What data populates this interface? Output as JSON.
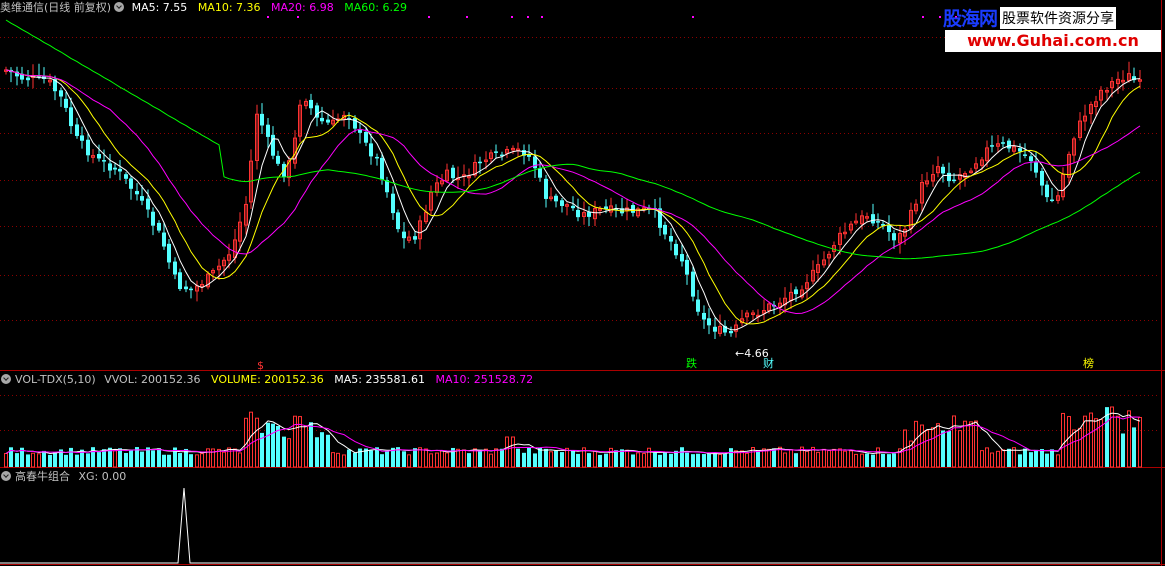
{
  "main_panel": {
    "stock_title": "奥维通信(日线 前复权)",
    "indicators": [
      {
        "label": "MA5: 7.55",
        "color": "#ffffff"
      },
      {
        "label": "MA10: 7.36",
        "color": "#ffff00"
      },
      {
        "label": "MA20: 6.98",
        "color": "#ff00ff"
      },
      {
        "label": "MA60: 6.29",
        "color": "#00ff00"
      }
    ],
    "low_price_label": "4.66",
    "signals": {
      "s1": "$",
      "s2": "跌",
      "s3": "财",
      "s4": "榜"
    }
  },
  "volume_panel": {
    "title": "VOL-TDX(5,10)",
    "indicators": [
      {
        "label": "VVOL: 200152.36",
        "color": "#c0c0c0"
      },
      {
        "label": "VOLUME: 200152.36",
        "color": "#ffff00"
      },
      {
        "label": "MA5: 235581.61",
        "color": "#ffffff"
      },
      {
        "label": "MA10: 251528.72",
        "color": "#ff00ff"
      }
    ]
  },
  "xg_panel": {
    "title": "高春牛组合",
    "indicators": [
      {
        "label": "XG: 0.00",
        "color": "#c0c0c0"
      }
    ]
  },
  "watermark": {
    "brand": "股海网",
    "slogan": "股票软件资源分享",
    "url": "www.Guhai.com.cn"
  },
  "colors": {
    "up": "#ff3232",
    "down": "#54ffff",
    "ma5": "#ffffff",
    "ma10": "#ffff00",
    "ma20": "#ff00ff",
    "ma60": "#00ff00",
    "grid": "#8b0000",
    "border": "#aa0000"
  }
}
